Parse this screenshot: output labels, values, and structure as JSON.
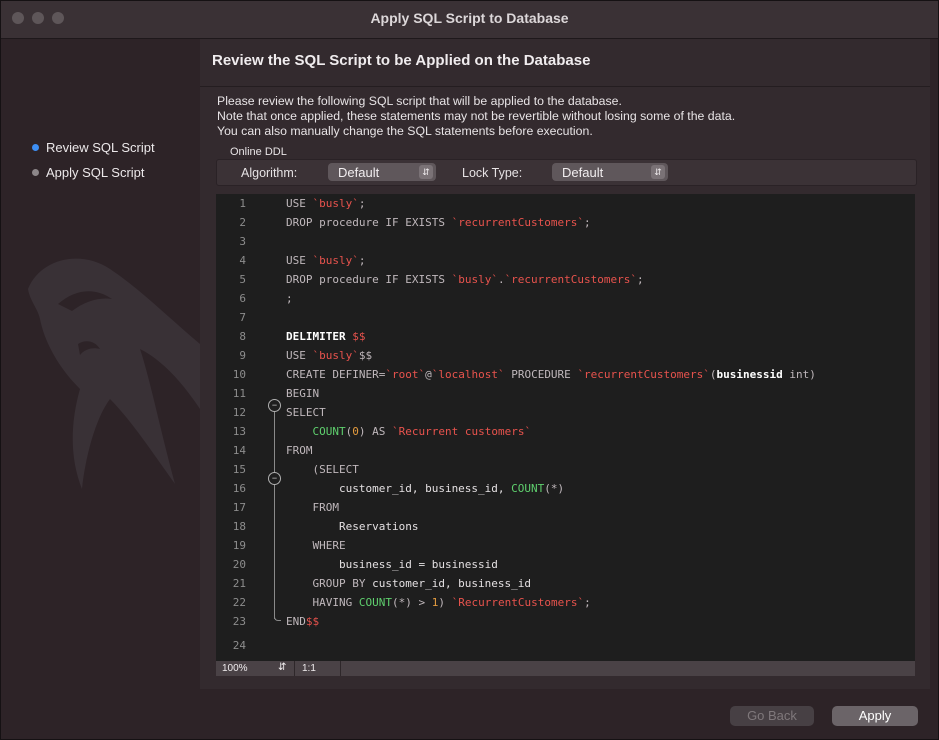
{
  "window": {
    "title": "Apply SQL Script to Database"
  },
  "sidebar": {
    "steps": [
      {
        "label": "Review SQL Script",
        "active": true
      },
      {
        "label": "Apply SQL Script",
        "active": false
      }
    ]
  },
  "main": {
    "heading": "Review the SQL Script to be Applied on the Database",
    "description": [
      "Please review the following SQL script that will be applied to the database.",
      "Note that once applied, these statements may not be revertible without losing some of the data.",
      "You can also manually change the SQL statements before execution."
    ],
    "online_ddl": {
      "label": "Online DDL",
      "algorithm_label": "Algorithm:",
      "algorithm_value": "Default",
      "lock_type_label": "Lock Type:",
      "lock_type_value": "Default"
    }
  },
  "editor": {
    "lines": [
      {
        "n": "1"
      },
      {
        "n": "2"
      },
      {
        "n": "3"
      },
      {
        "n": "4"
      },
      {
        "n": "5"
      },
      {
        "n": "6"
      },
      {
        "n": "7"
      },
      {
        "n": "8"
      },
      {
        "n": "9"
      },
      {
        "n": "10"
      },
      {
        "n": "11"
      },
      {
        "n": "12"
      },
      {
        "n": "13"
      },
      {
        "n": "14"
      },
      {
        "n": "15"
      },
      {
        "n": "16"
      },
      {
        "n": "17"
      },
      {
        "n": "18"
      },
      {
        "n": "19"
      },
      {
        "n": "20"
      },
      {
        "n": "21"
      },
      {
        "n": "22"
      },
      {
        "n": "23"
      },
      {
        "n": "24"
      }
    ],
    "code": {
      "l1": [
        "USE ",
        "`busly`",
        ";"
      ],
      "l2": [
        "DROP procedure IF EXISTS ",
        "`recurrentCustomers`",
        ";"
      ],
      "l4": [
        "USE ",
        "`busly`",
        ";"
      ],
      "l5": [
        "DROP procedure IF EXISTS ",
        "`busly`",
        ".",
        "`recurrentCustomers`",
        ";"
      ],
      "l6": [
        ";"
      ],
      "l8": [
        "DELIMITER ",
        "$$"
      ],
      "l9": [
        "USE ",
        "`busly`",
        "$$"
      ],
      "l10": [
        "CREATE DEFINER=",
        "`root`",
        "@",
        "`localhost`",
        " PROCEDURE ",
        "`recurrentCustomers`",
        "(",
        "businessid",
        " int)"
      ],
      "l11": [
        "BEGIN"
      ],
      "l12": [
        "SELECT"
      ],
      "l13": [
        "    ",
        "COUNT",
        "(",
        "0",
        ") AS ",
        "`Recurrent customers`"
      ],
      "l14": [
        "FROM"
      ],
      "l15": [
        "    (SELECT"
      ],
      "l16": [
        "        customer_id, business_id, ",
        "COUNT",
        "(*)"
      ],
      "l17": [
        "    FROM"
      ],
      "l18": [
        "        Reservations"
      ],
      "l19": [
        "    WHERE"
      ],
      "l20": [
        "        business_id = businessid"
      ],
      "l21": [
        "    GROUP BY ",
        "customer_id, business_id"
      ],
      "l22": [
        "    HAVING ",
        "COUNT",
        "(*) > ",
        "1",
        ") ",
        "`RecurrentCustomers`",
        ";"
      ],
      "l23": [
        "END",
        "$$"
      ]
    }
  },
  "statusbar": {
    "zoom": "100%",
    "position": "1:1"
  },
  "footer": {
    "go_back_label": "Go Back",
    "apply_label": "Apply"
  },
  "colors": {
    "string": "#e8534d",
    "number": "#e39b3f",
    "function": "#5fd06e",
    "active_step": "#3d8ef3"
  }
}
